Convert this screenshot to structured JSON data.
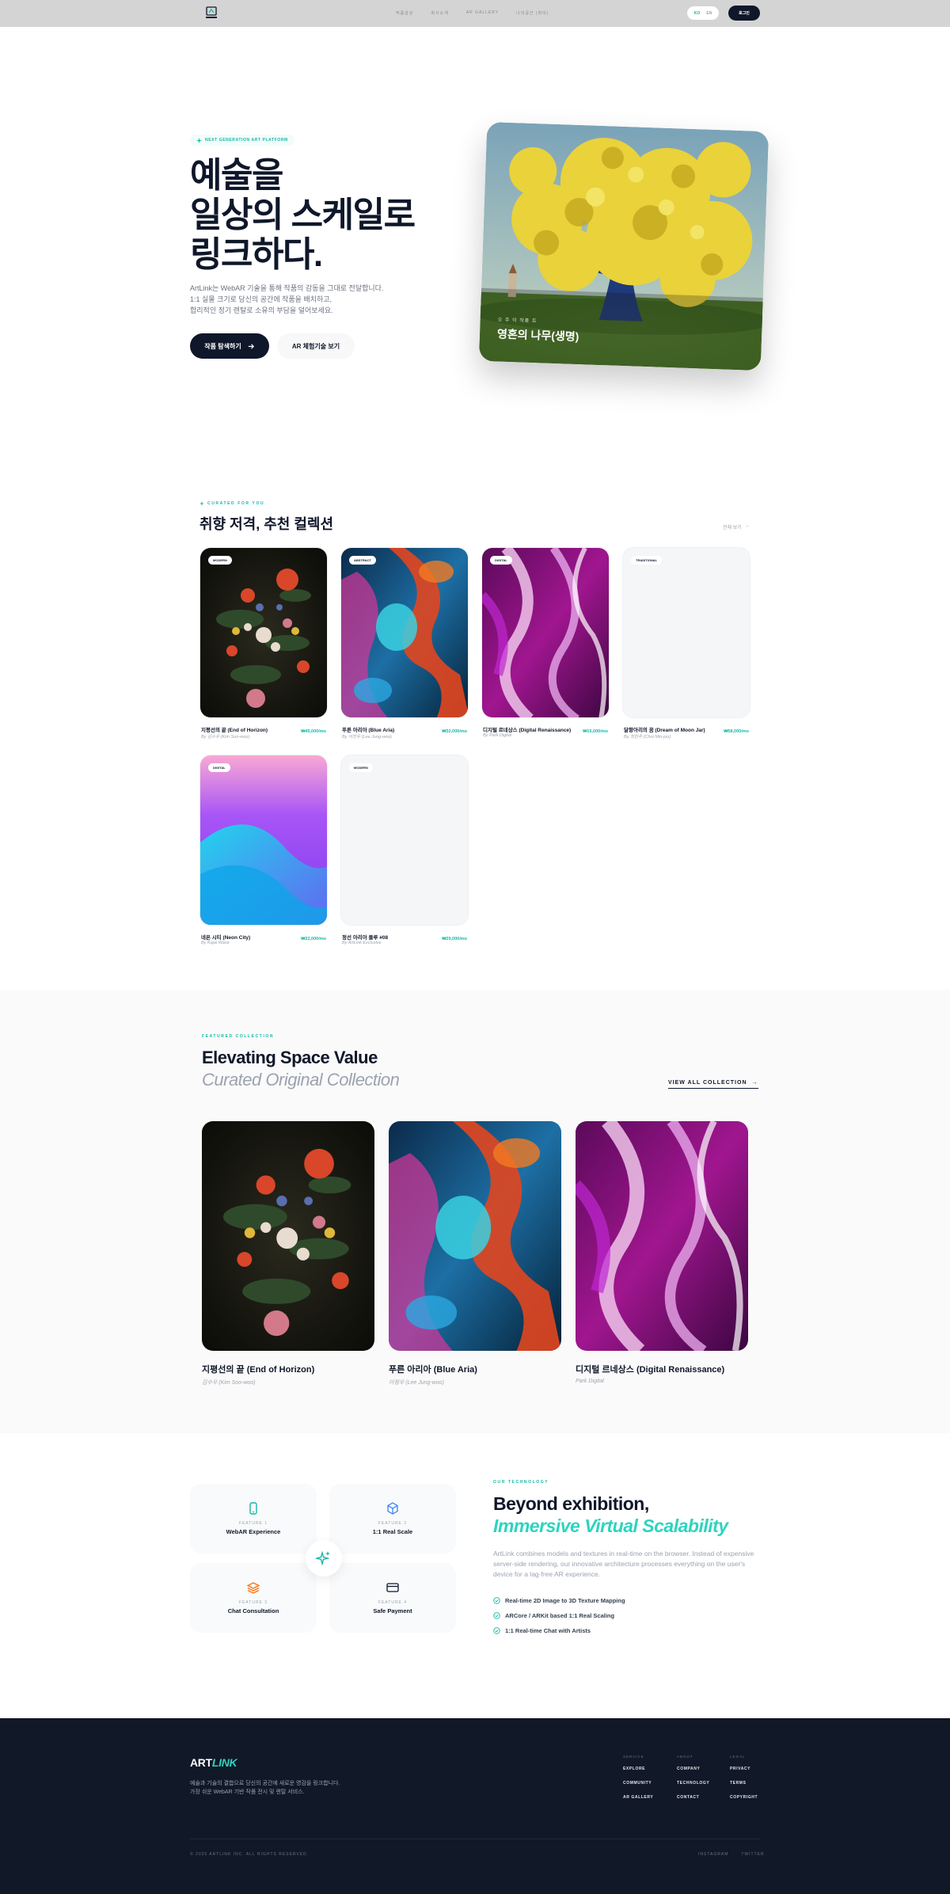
{
  "nav": {
    "links": [
      "작품감상",
      "회사소개",
      "AR GALLERY",
      "나의공간 (마이)"
    ],
    "lang_active": "KO",
    "lang_inactive": "EN",
    "login": "로그인"
  },
  "hero": {
    "badge": "NEXT GENERATION ART PLATFORM",
    "title": "예술을\n일상의 스케일로\n링크하다.",
    "desc": "ArtLink는 WebAR 기술을 통해 작품의 감동을 그대로 전달합니다.\n1:1 실물 크기로 당신의 공간에 작품을 배치하고,\n합리적인 정기 렌탈로 소유의 부담을 덜어보세요.",
    "btn_primary": "작품 탐색하기",
    "btn_secondary": "AR 체험기술 보기",
    "card_sub": "오 주 이 작품 트",
    "card_title": "영혼의 나무(생명)"
  },
  "curated": {
    "eyebrow": "CURATED FOR YOU",
    "title": "취향 저격, 추천 컬렉션",
    "view_all": "전체 보기",
    "items": [
      {
        "tag": "MODERN",
        "name": "지평선의 끝 (End of Horizon)",
        "artist": "By 김수우 (Kim Sun-woo)",
        "price": "₩45,000/mo"
      },
      {
        "tag": "ABSTRACT",
        "name": "푸른 아리아 (Blue Aria)",
        "artist": "By 이정우 (Lee Jung-woo)",
        "price": "₩32,000/mo"
      },
      {
        "tag": "DIGITAL",
        "name": "디지털 르네상스 (Digital Renaissance)",
        "artist": "By Park Digital",
        "price": "₩15,000/mo"
      },
      {
        "tag": "TRADITIONAL",
        "name": "달항아리의 꿈 (Dream of Moon Jar)",
        "artist": "By 최민주 (Choi Min-joo)",
        "price": "₩58,000/mo"
      },
      {
        "tag": "DIGITAL",
        "name": "네온 시티 (Neon City)",
        "artist": "By Kajai Wave",
        "price": "₩22,000/mo"
      },
      {
        "tag": "MODERN",
        "name": "정선 아리아 플루 #08",
        "artist": "By ArtLink Exclusive",
        "price": "₩29,000/mo"
      }
    ]
  },
  "featured": {
    "eyebrow": "FEATURED COLLECTION",
    "title1": "Elevating Space Value",
    "title2": "Curated Original Collection",
    "view_all": "VIEW ALL COLLECTION",
    "items": [
      {
        "name": "지평선의 끝 (End of Horizon)",
        "artist": "김수우 (Kim Soo-woo)"
      },
      {
        "name": "푸른 아리아 (Blue Aria)",
        "artist": "이정우 (Lee Jung-woo)"
      },
      {
        "name": "디지털 르네상스 (Digital Renaissance)",
        "artist": "Park Digital"
      }
    ]
  },
  "tech": {
    "features": [
      {
        "label": "FEATURE 1",
        "title": "WebAR Experience",
        "icon": "phone-icon"
      },
      {
        "label": "FEATURE 2",
        "title": "1:1 Real Scale",
        "icon": "cube-icon"
      },
      {
        "label": "FEATURE 3",
        "title": "Chat Consultation",
        "icon": "layers-icon"
      },
      {
        "label": "FEATURE 4",
        "title": "Safe Payment",
        "icon": "card-icon"
      }
    ],
    "eyebrow": "OUR TECHNOLOGY",
    "title1": "Beyond exhibition,",
    "title2": "Immersive Virtual Scalability",
    "desc": "ArtLink combines models and textures in real-time on the browser. Instead of expensive server-side rendering, our innovative architecture processes everything on the user's device for a lag-free AR experience.",
    "checks": [
      "Real-time 2D Image to 3D Texture Mapping",
      "ARCore / ARKit based 1:1 Real Scaling",
      "1:1 Real-time Chat with Artists"
    ]
  },
  "footer": {
    "logo_a": "ART",
    "logo_b": "LINK",
    "desc": "예술과 기술의 결합으로 당신의 공간에 새로운 영감을 링크합니다.\n가장 쉬운 WebAR 기반 작품 전시 및 렌탈 서비스.",
    "cols": [
      {
        "head": "SERVICE",
        "items": [
          "EXPLORE",
          "COMMUNITY",
          "AR GALLERY"
        ]
      },
      {
        "head": "ABOUT",
        "items": [
          "COMPANY",
          "TECHNOLOGY",
          "CONTACT"
        ]
      },
      {
        "head": "LEGAL",
        "items": [
          "PRIVACY",
          "TERMS",
          "COPYRIGHT"
        ]
      }
    ],
    "copyright": "© 2025 ARTLINK INC. ALL RIGHTS RESERVED.",
    "social": [
      "INSTAGRAM",
      "TWITTER"
    ]
  },
  "colors": {
    "accent": "#14b8a6",
    "dark": "#0f172a",
    "footer_bg": "#111827"
  }
}
